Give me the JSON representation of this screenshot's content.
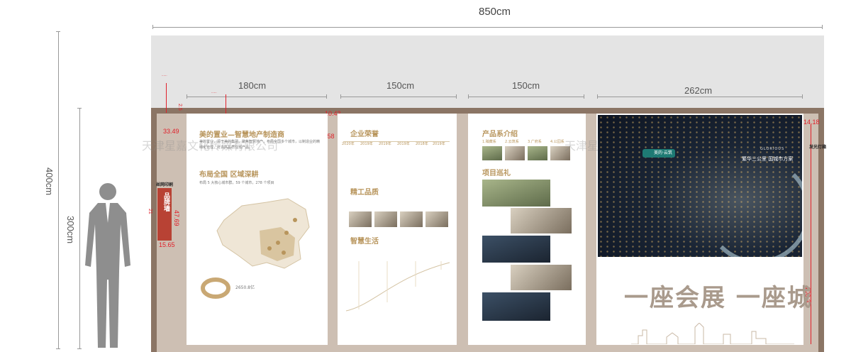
{
  "dimensions": {
    "total_width": "850cm",
    "total_height": "400cm",
    "wall_height": "300cm",
    "section_widths": [
      "180cm",
      "150cm",
      "150cm",
      "262cm"
    ]
  },
  "measurements": {
    "m1": "33.49",
    "m2": "10.43",
    "m3": "2.58",
    "m4": "47.69",
    "m5": "15.65",
    "m6": "14.18",
    "m7": "108.3",
    "m8": "21",
    "m9": "2.5"
  },
  "watermark": {
    "text": "天津星嘉文化传媒有限公司",
    "short": "天津星"
  },
  "labels": {
    "brand_wall_print": "丝网印刷",
    "brand_wall": "品牌墙",
    "light_box": "发光灯箱"
  },
  "panel1": {
    "title": "美的置业—智慧地产制造商",
    "body": "美的置业，源于美的集团，聚焦智慧地产，布局全国多个城市，以制造业的精细化管理，打造高品质住宅产品。",
    "section2_title": "布局全国 区域深耕",
    "section2_body": "布局 5 大核心城市群，59 个城市，278 个项目",
    "count_a": "5",
    "count_b": "59",
    "count_c": "278",
    "stat_value": "2650.8亿"
  },
  "panel2": {
    "title": "企业荣誉",
    "years": [
      "2020年",
      "2019年",
      "2019年",
      "2019年",
      "2018年",
      "2019年"
    ],
    "section2_title": "精工品质",
    "section3_title": "智慧生活"
  },
  "panel3": {
    "title": "产品系介绍",
    "series": [
      "1.臻藏系",
      "2.云筑系",
      "3.广府系",
      "4.公园系"
    ],
    "section2_title": "项目巡礼"
  },
  "panel4": {
    "logo": "美的·云筑",
    "tagline": "繁华三公里 国城市方案",
    "brand": "GLORIOUS",
    "slogan": "一座会展 一座城"
  },
  "colors": {
    "frame": "#8b7565",
    "gold": "#b8955c",
    "annotation_red": "#e0202a",
    "brand_wall_red": "#b84234"
  }
}
